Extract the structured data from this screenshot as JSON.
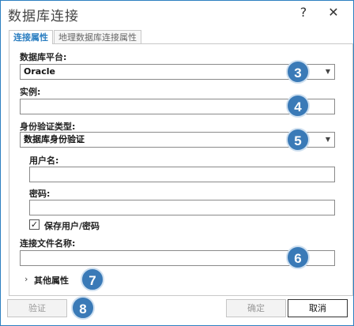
{
  "window": {
    "title": "数据库连接",
    "help_glyph": "?",
    "close_glyph": "✕"
  },
  "tabs": [
    {
      "label": "连接属性",
      "active": true
    },
    {
      "label": "地理数据库连接属性",
      "active": false
    }
  ],
  "form": {
    "platform_label": "数据库平台:",
    "platform_value": "Oracle",
    "instance_label": "实例:",
    "instance_value": "",
    "auth_type_label": "身份验证类型:",
    "auth_type_value": "数据库身份验证",
    "username_label": "用户名:",
    "username_value": "",
    "password_label": "密码:",
    "password_value": "",
    "save_credentials_label": "保存用户/密码",
    "save_credentials_checked": true,
    "connection_file_label": "连接文件名称:",
    "connection_file_value": "",
    "more_properties_label": "其他属性"
  },
  "callouts": [
    "3",
    "4",
    "5",
    "6",
    "7",
    "8"
  ],
  "buttons": {
    "validate": "验证",
    "ok": "确定",
    "cancel": "取消"
  },
  "icons": {
    "select_arrow": "chevron-down-icon",
    "check": "checkmark-icon",
    "expand": "chevron-right-icon"
  },
  "colors": {
    "accent": "#2d7fc1",
    "callout": "#3a7ab7"
  }
}
